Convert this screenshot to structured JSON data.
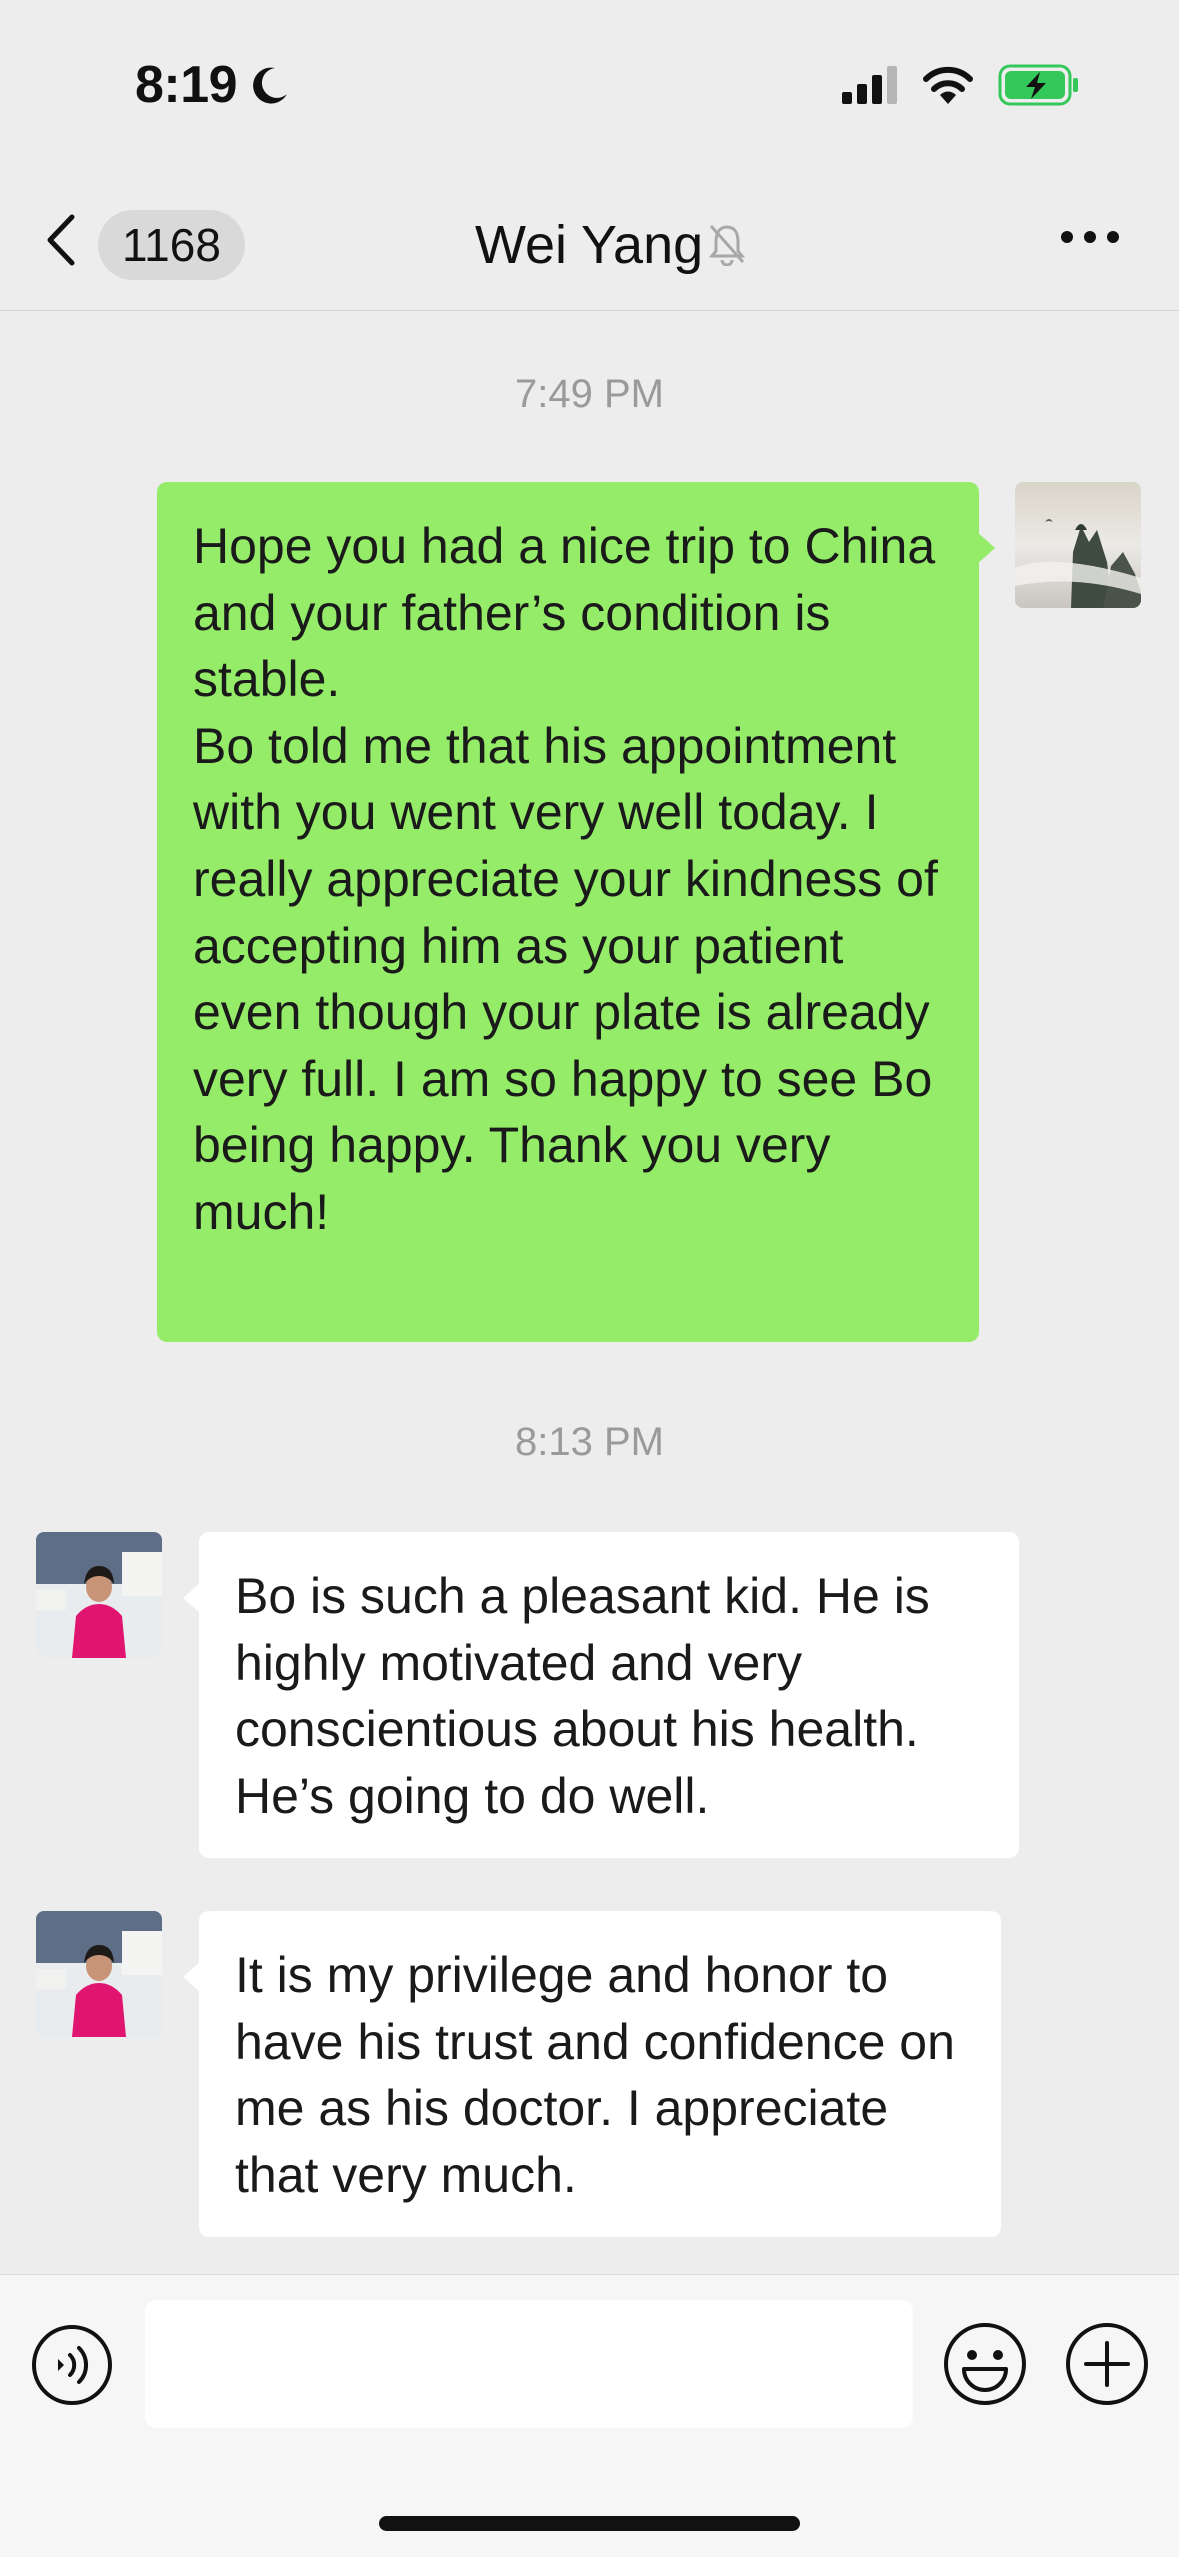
{
  "status_bar": {
    "time": "8:19",
    "icons": [
      "moon-icon",
      "signal-icon",
      "wifi-icon",
      "battery-charging-icon"
    ],
    "battery_color": "#34c759"
  },
  "header": {
    "back_icon": "chevron-left-icon",
    "unread_count": "1168",
    "title": "Wei Yang",
    "mute_icon": "bell-slash-icon",
    "more_icon": "ellipsis-icon"
  },
  "messages": [
    {
      "type": "timestamp",
      "text": "7:49 PM"
    },
    {
      "type": "outgoing",
      "text": "Hope you had a nice trip to China and your father’s condition is stable.\nBo told me that his appointment with you went very well today. I really appreciate your kindness of accepting him as your patient even though your plate is already very full. I am so happy to see Bo being happy. Thank you very much!"
    },
    {
      "type": "timestamp",
      "text": "8:13 PM"
    },
    {
      "type": "incoming",
      "text": "Bo is such a pleasant kid. He is highly motivated and very conscientious about his health. He’s going to do well."
    },
    {
      "type": "incoming",
      "text": "It is my privilege and honor to have his trust and confidence on me as his doctor. I appreciate that very much."
    }
  ],
  "input_bar": {
    "voice_icon": "voice-icon",
    "input_value": "",
    "emoji_icon": "emoji-icon",
    "plus_icon": "plus-circle-icon"
  },
  "colors": {
    "outgoing_bubble": "#95ec69",
    "incoming_bubble": "#ffffff",
    "background": "#ededed"
  }
}
